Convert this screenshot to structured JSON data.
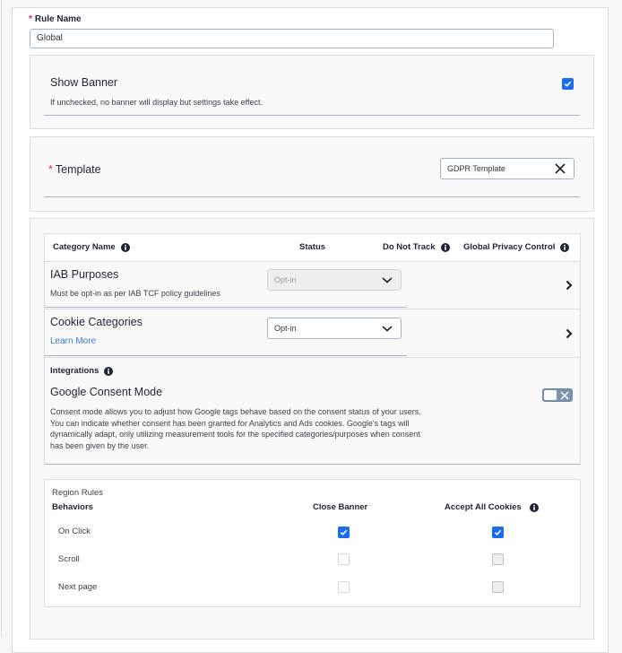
{
  "rule_name": {
    "label": "Rule Name",
    "required_marker": "*",
    "value": "Global"
  },
  "show_banner": {
    "title": "Show Banner",
    "description": "If unchecked, no banner will display but settings take effect.",
    "checked": true
  },
  "template": {
    "label": "Template",
    "required_marker": "*",
    "selected": "GDPR Template",
    "clear_icon": "close-icon"
  },
  "categories_table": {
    "headers": {
      "category_name": "Category Name",
      "status": "Status",
      "do_not_track": "Do Not Track",
      "global_privacy_control": "Global Privacy Control"
    },
    "rows": [
      {
        "title": "IAB Purposes",
        "subtitle": "Must be opt-in as per IAB TCF policy guidelines",
        "status": "Opt-in",
        "status_disabled": true
      },
      {
        "title": "Cookie Categories",
        "link": "Learn More",
        "status": "Opt-in",
        "status_disabled": false
      }
    ],
    "integrations": {
      "label": "Integrations",
      "title": "Google Consent Mode",
      "description": "Consent mode allows you to adjust how Google tags behave based on the consent status of your users. You can indicate whether consent has been granted for Analytics and Ads cookies. Google's tags will dynamically adapt, only utilizing measurement tools for the specified categories/purposes when consent has been given by the user.",
      "enabled": false
    }
  },
  "region_rules": {
    "title": "Region Rules",
    "headers": {
      "behaviors": "Behaviors",
      "close_banner": "Close Banner",
      "accept_all_cookies": "Accept All Cookies"
    },
    "rows": [
      {
        "label": "On Click",
        "close_banner": true,
        "accept_all": true
      },
      {
        "label": "Scroll",
        "close_banner": false,
        "accept_all": false
      },
      {
        "label": "Next page",
        "close_banner": false,
        "accept_all": false
      }
    ]
  },
  "colors": {
    "accent": "#1a6cf0",
    "required": "#e0245e",
    "link": "#3a7bd5",
    "toggle_off": "#7c94ad"
  }
}
